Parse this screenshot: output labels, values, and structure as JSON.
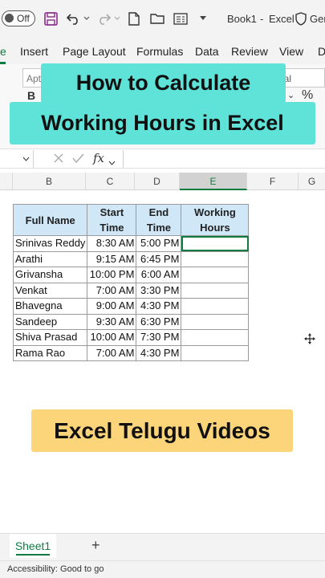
{
  "titlebar": {
    "autosave_label": "Off",
    "file_name": "Book1",
    "separator": "-",
    "app_name": "Excel",
    "sensitivity_label": "Ger"
  },
  "ribbon": {
    "tabs": [
      {
        "label": "e",
        "active": true
      },
      {
        "label": "Insert"
      },
      {
        "label": "Page Layout"
      },
      {
        "label": "Formulas"
      },
      {
        "label": "Data"
      },
      {
        "label": "Review"
      },
      {
        "label": "View"
      },
      {
        "label": "D"
      }
    ],
    "font_name": "Apt",
    "number_format": "eral",
    "bold_label": "B",
    "percent_label": "%"
  },
  "overlay": {
    "line1": "How to Calculate",
    "line2": "Working Hours in Excel",
    "footer": "Excel Telugu Videos"
  },
  "formula_bar": {
    "fx_label": "fx",
    "value": ""
  },
  "columns": [
    "B",
    "C",
    "D",
    "E",
    "F",
    "G"
  ],
  "selected_column": "E",
  "table": {
    "headers": [
      [
        "Full Name"
      ],
      [
        "Start",
        "Time"
      ],
      [
        "End",
        "Time"
      ],
      [
        "Working",
        "Hours"
      ]
    ],
    "rows": [
      [
        "Srinivas Reddy",
        "8:30 AM",
        "5:00 PM",
        ""
      ],
      [
        "Arathi",
        "9:15 AM",
        "6:45 PM",
        ""
      ],
      [
        "Grivansha",
        "10:00 PM",
        "6:00 AM",
        ""
      ],
      [
        "Venkat",
        "7:00 AM",
        "3:30 PM",
        ""
      ],
      [
        "Bhavegna",
        "9:00 AM",
        "4:30 PM",
        ""
      ],
      [
        "Sandeep",
        "9:30 AM",
        "6:30 PM",
        ""
      ],
      [
        "Shiva Prasad",
        "10:00 AM",
        "7:30 PM",
        ""
      ],
      [
        "Rama Rao",
        "7:00 AM",
        "4:30 PM",
        ""
      ]
    ]
  },
  "sheets": {
    "tabs": [
      "Sheet1"
    ],
    "add_label": "+"
  },
  "status_bar": {
    "accessibility": "Accessibility: Good to go"
  },
  "colors": {
    "excel_green": "#107c41",
    "banner_teal": "#5fe3d9",
    "banner_yellow": "#fcd47a",
    "header_fill": "#cfe7f7"
  }
}
